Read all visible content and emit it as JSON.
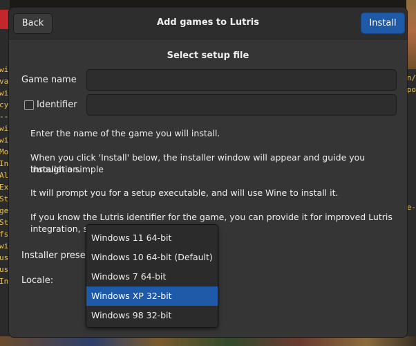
{
  "dialog": {
    "title": "Add games to Lutris",
    "back_label": "Back",
    "install_label": "Install",
    "section_title": "Select setup file"
  },
  "form": {
    "game_name_label": "Game name",
    "game_name_value": "",
    "identifier_label": "Identifier",
    "identifier_checked": false,
    "identifier_value": "",
    "installer_preset_label": "Installer preset:",
    "locale_label": "Locale:"
  },
  "info": {
    "p1": "Enter the name of the game you will install.",
    "p2_line1": "When you click 'Install' below, the installer window will appear and guide you through a simple",
    "p2_line2": "installation.",
    "p3": "It will prompt you for a setup executable, and will use Wine to install it.",
    "p4_line1": "If you know the Lutris identifier for the game, you can provide it for improved Lutris",
    "p4_line2": "integration, su"
  },
  "preset_menu": {
    "items": [
      {
        "label": "Windows 11 64-bit",
        "selected": false
      },
      {
        "label": "Windows 10 64-bit (Default)",
        "selected": false
      },
      {
        "label": "Windows 7 64-bit",
        "selected": false
      },
      {
        "label": "Windows XP 32-bit",
        "selected": true
      },
      {
        "label": "Windows 98 32-bit",
        "selected": false
      }
    ]
  },
  "background": {
    "left_terminal": [
      "wi",
      "va",
      "wi",
      "cy",
      "--",
      "wi",
      "wi",
      "Mo",
      "In",
      "Al",
      "Ex",
      "St",
      "ge",
      "St",
      "fs",
      "wi",
      "us",
      "us",
      "In"
    ],
    "right_terminal": [
      "n/",
      "po",
      "e-"
    ]
  },
  "colors": {
    "accent": "#1e5aa8",
    "dialog_bg": "#353535",
    "headerbar_bg": "#2d2d2d",
    "terminal_text": "#e7c25b"
  }
}
